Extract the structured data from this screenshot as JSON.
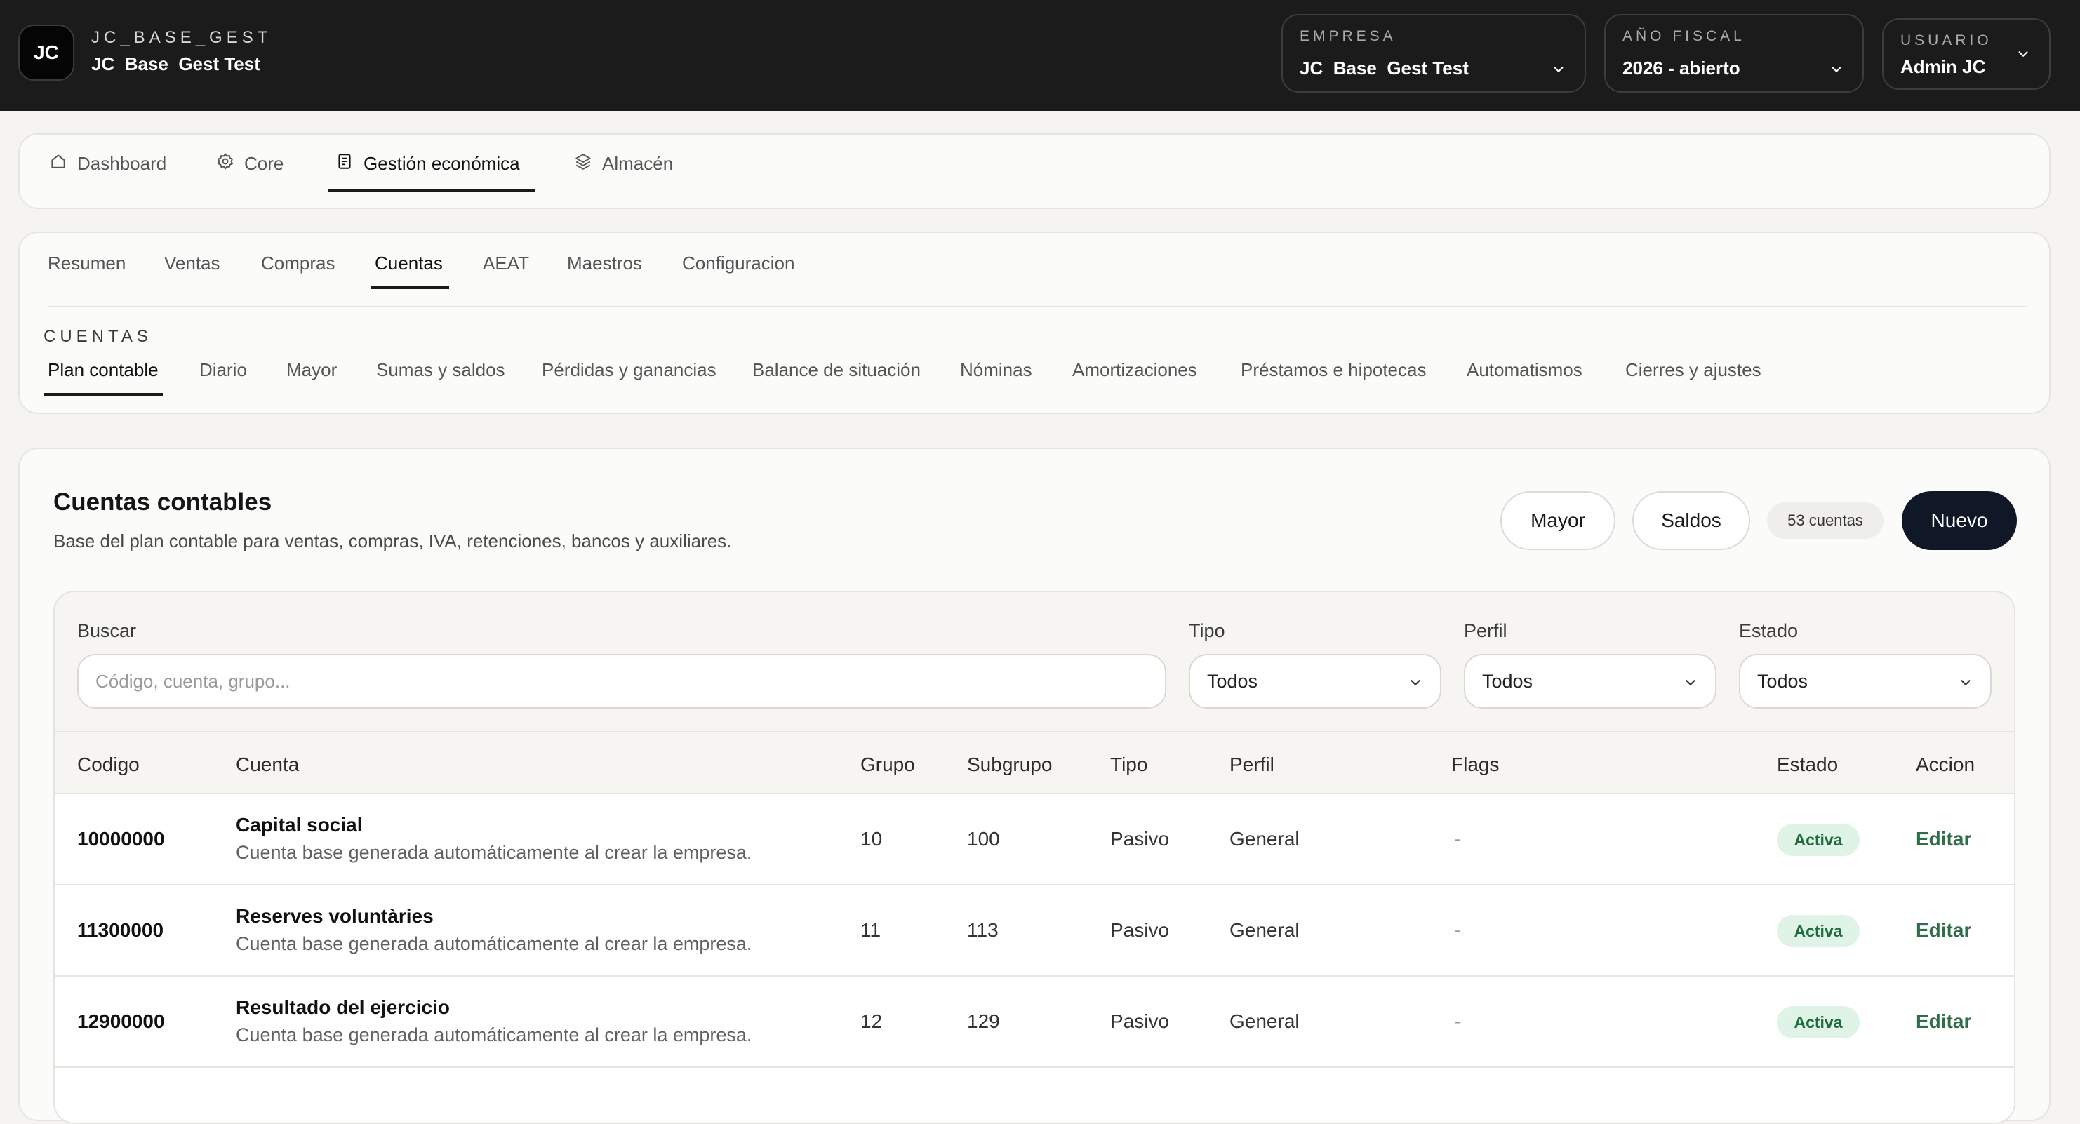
{
  "header": {
    "logo_text": "JC",
    "brand_kicker": "JC_BASE_GEST",
    "brand_title": "JC_Base_Gest Test",
    "empresa": {
      "label": "EMPRESA",
      "value": "JC_Base_Gest Test"
    },
    "fiscal": {
      "label": "AÑO FISCAL",
      "value": "2026 - abierto"
    },
    "usuario": {
      "label": "USUARIO",
      "value": "Admin JC"
    }
  },
  "modules": [
    {
      "label": "Dashboard",
      "icon": "home-icon"
    },
    {
      "label": "Core",
      "icon": "gear-icon"
    },
    {
      "label": "Gestión económica",
      "icon": "document-icon",
      "active": true
    },
    {
      "label": "Almacén",
      "icon": "layers-icon"
    }
  ],
  "tabs": [
    "Resumen",
    "Ventas",
    "Compras",
    "Cuentas",
    "AEAT",
    "Maestros",
    "Configuracion"
  ],
  "active_tab": "Cuentas",
  "section_kicker": "CUENTAS",
  "subtabs": [
    "Plan contable",
    "Diario",
    "Mayor",
    "Sumas y saldos",
    "Pérdidas y ganancias",
    "Balance de situación",
    "Nóminas",
    "Amortizaciones",
    "Préstamos e hipotecas",
    "Automatismos",
    "Cierres y ajustes"
  ],
  "active_subtab": "Plan contable",
  "main": {
    "title": "Cuentas contables",
    "subtitle": "Base del plan contable para ventas, compras, IVA, retenciones, bancos y auxiliares.",
    "btn_mayor": "Mayor",
    "btn_saldos": "Saldos",
    "count": "53 cuentas",
    "btn_nuevo": "Nuevo"
  },
  "filters": {
    "search_label": "Buscar",
    "search_placeholder": "Código, cuenta, grupo...",
    "tipo_label": "Tipo",
    "tipo_value": "Todos",
    "perfil_label": "Perfil",
    "perfil_value": "Todos",
    "estado_label": "Estado",
    "estado_value": "Todos"
  },
  "table": {
    "headers": [
      "Codigo",
      "Cuenta",
      "Grupo",
      "Subgrupo",
      "Tipo",
      "Perfil",
      "Flags",
      "Estado",
      "Accion"
    ],
    "rows": [
      {
        "code": "10000000",
        "name": "Capital social",
        "desc": "Cuenta base generada automáticamente al crear la empresa.",
        "grupo": "10",
        "subgrupo": "100",
        "tipo": "Pasivo",
        "perfil": "General",
        "flags": "-",
        "estado": "Activa",
        "accion": "Editar"
      },
      {
        "code": "11300000",
        "name": "Reserves voluntàries",
        "desc": "Cuenta base generada automáticamente al crear la empresa.",
        "grupo": "11",
        "subgrupo": "113",
        "tipo": "Pasivo",
        "perfil": "General",
        "flags": "-",
        "estado": "Activa",
        "accion": "Editar"
      },
      {
        "code": "12900000",
        "name": "Resultado del ejercicio",
        "desc": "Cuenta base generada automáticamente al crear la empresa.",
        "grupo": "12",
        "subgrupo": "129",
        "tipo": "Pasivo",
        "perfil": "General",
        "flags": "-",
        "estado": "Activa",
        "accion": "Editar"
      }
    ]
  },
  "colors": {
    "header_bg": "#1b1b1b",
    "primary": "#101726",
    "active_badge_bg": "#dff3e6",
    "active_badge_text": "#1e6b3d",
    "link": "#2f6d4b"
  }
}
